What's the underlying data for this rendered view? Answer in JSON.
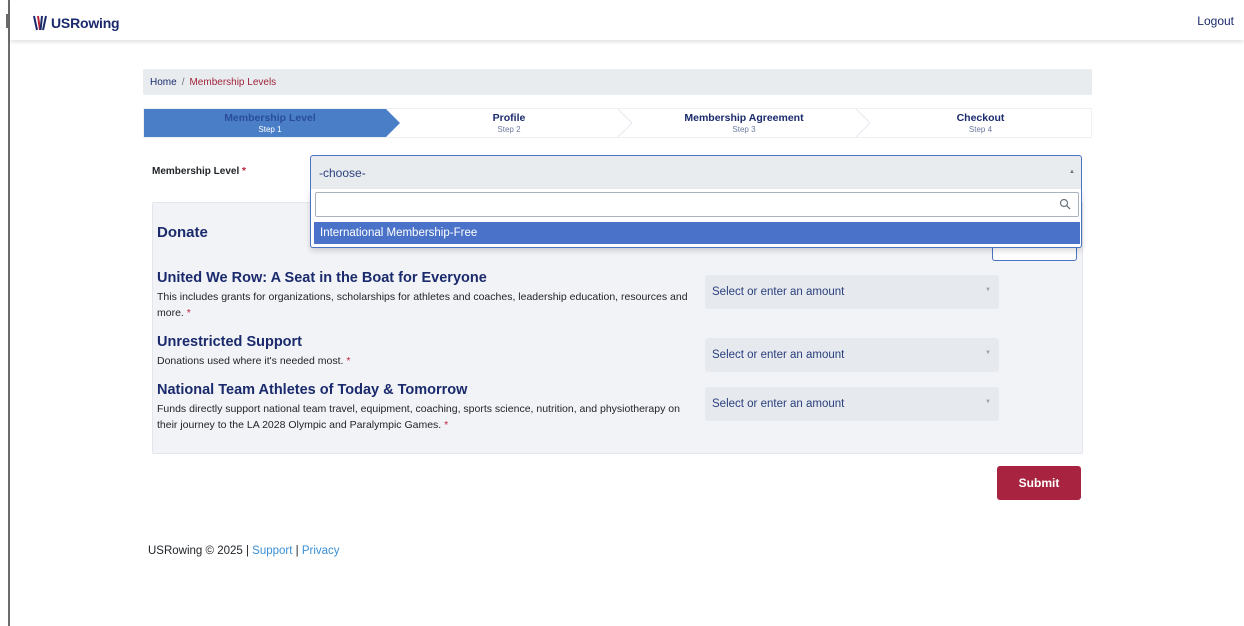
{
  "header": {
    "logo_us": "US",
    "logo_rowing": "Rowing",
    "logout_label": "Logout"
  },
  "breadcrumb": {
    "home": "Home",
    "separator": "/",
    "current": "Membership Levels"
  },
  "steps": [
    {
      "title": "Membership Level",
      "sub": "Step 1",
      "active": true
    },
    {
      "title": "Profile",
      "sub": "Step 2",
      "active": false
    },
    {
      "title": "Membership Agreement",
      "sub": "Step 3",
      "active": false
    },
    {
      "title": "Checkout",
      "sub": "Step 4",
      "active": false
    }
  ],
  "membership": {
    "label": "Membership Level",
    "required_mark": "*",
    "selected_value": "-choose-",
    "search_value": "",
    "options": [
      "International Membership-Free"
    ]
  },
  "donate": {
    "title": "Donate",
    "funds": [
      {
        "title": "United We Row: A Seat in the Boat for Everyone",
        "description": "This includes grants for organizations, scholarships for athletes and coaches, leadership education, resources and more.",
        "required_mark": "*",
        "amount_placeholder": "Select or enter an amount"
      },
      {
        "title": "Unrestricted Support",
        "description": "Donations used where it's needed most.",
        "required_mark": "*",
        "amount_placeholder": "Select or enter an amount"
      },
      {
        "title": "National Team Athletes of Today & Tomorrow",
        "description": "Funds directly support national team travel, equipment, coaching, sports science, nutrition, and physiotherapy on their journey to the LA 2028 Olympic and Paralympic Games.",
        "required_mark": "*",
        "amount_placeholder": "Select or enter an amount"
      }
    ]
  },
  "submit_label": "Submit",
  "footer": {
    "copyright": "USRowing © 2025 |",
    "support": "Support",
    "divider": "|",
    "privacy": "Privacy"
  },
  "colors": {
    "brand_navy": "#1a2a6c",
    "brand_red": "#a8233f",
    "active_step": "#4a7fc8",
    "option_highlight": "#4a72c8",
    "link_blue": "#3a8fd6"
  }
}
